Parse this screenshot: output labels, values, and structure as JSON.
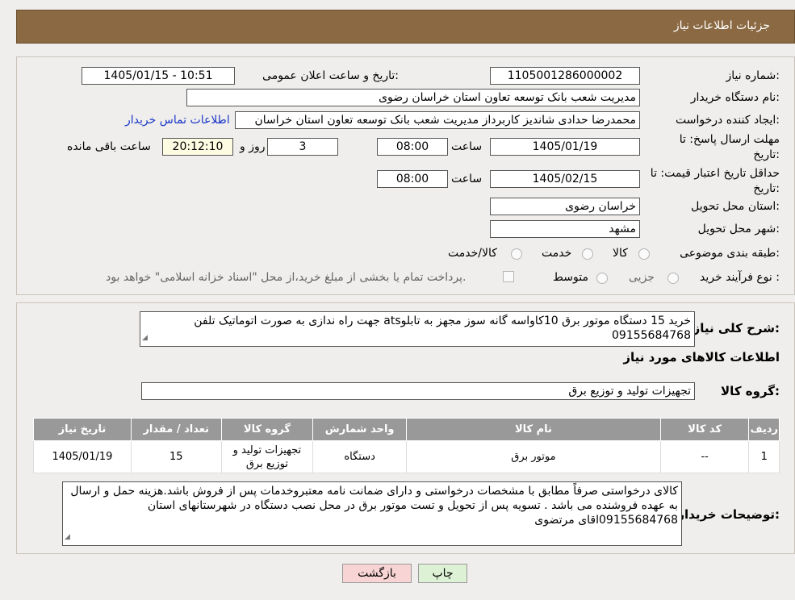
{
  "header": {
    "title": "جزئیات اطلاعات نیاز"
  },
  "form": {
    "need_number_label": "شماره نیاز:",
    "need_number": "1105001286000002",
    "announce_label": "تاریخ و ساعت اعلان عمومی:",
    "announce_value": "1405/01/15 - 10:51",
    "buyer_org_label": "نام دستگاه خریدار:",
    "buyer_org": "مدیریت شعب بانک توسعه تعاون استان خراسان رضوی",
    "creator_label": "ایجاد کننده درخواست:",
    "creator": "محمدرضا حدادی شاندیز کاربرداز مدیریت شعب بانک توسعه تعاون استان خراسان",
    "contact_link": "اطلاعات تماس خریدار",
    "deadline_label_line1": "مهلت ارسال پاسخ: تا",
    "deadline_label_line2": "تاریخ:",
    "deadline_date": "1405/01/19",
    "time_label": "ساعت",
    "deadline_time": "08:00",
    "days_value": "3",
    "days_label": "روز و",
    "remaining_time": "20:12:10",
    "remaining_label": "ساعت باقی مانده",
    "validity_label_line1": "حداقل تاریخ اعتبار قیمت: تا",
    "validity_label_line2": "تاریخ:",
    "validity_date": "1405/02/15",
    "validity_time": "08:00",
    "province_label": "استان محل تحویل:",
    "province": "خراسان رضوی",
    "city_label": "شهر محل تحویل:",
    "city": "مشهد",
    "category_label": "طبقه بندی موضوعی:",
    "category_options": [
      "کالا",
      "خدمت",
      "کالا/خدمت"
    ],
    "process_label": "نوع فرآیند خرید :",
    "process_options": [
      "جزیی",
      "متوسط"
    ],
    "treasury_note": "پرداخت تمام یا بخشی از مبلغ خرید،از محل \"اسناد خزانه اسلامی\" خواهد بود."
  },
  "description": {
    "label": "شرح کلی نیاز:",
    "text": "خرید 15 دستگاه موتور برق 10کاواسه گانه سوز مجهز به تابلوats جهت راه ندازی به صورت اتوماتیک تلفن 09155684768"
  },
  "goods": {
    "section_title": "اطلاعات کالاهای مورد نیاز",
    "group_label": "گروه کالا:",
    "group_value": "تجهیزات تولید و توزیع برق",
    "columns": [
      "ردیف",
      "کد کالا",
      "نام کالا",
      "واحد شمارش",
      "گروه کالا",
      "تعداد / مقدار",
      "تاریخ نیاز"
    ],
    "rows": [
      [
        "1",
        "--",
        "موتور برق",
        "دستگاه",
        "تجهیزات تولید و توزیع برق",
        "15",
        "1405/01/19"
      ]
    ]
  },
  "buyer_notes": {
    "label": "توضیحات خریدار:",
    "text": "کالای درخواستی صرفاً مطابق با مشخصات درخواستی و دارای ضمانت نامه معتبروخدمات پس از فروش باشد.هزینه حمل و ارسال به عهده فروشنده می باشد . تسویه پس از تحویل و تست موتور برق در محل نصب دستگاه در شهرستانهای استان 09155684768اقای مرتضوی"
  },
  "buttons": {
    "print": "چاپ",
    "back": "بازگشت"
  },
  "colors": {
    "header_bg": "#8b6a43",
    "link": "#1a37c8",
    "table_header": "#999999",
    "back_btn": "#f9d4d4",
    "print_btn": "#ddf2d4"
  }
}
